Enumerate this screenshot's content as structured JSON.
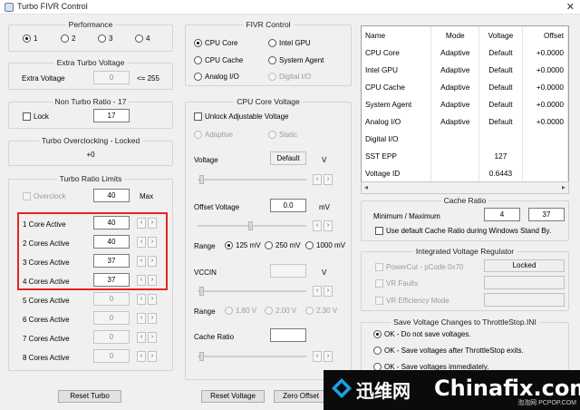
{
  "window": {
    "title": "Turbo FIVR Control",
    "close_glyph": "✕"
  },
  "performance": {
    "title": "Performance",
    "options": [
      "1",
      "2",
      "3",
      "4"
    ],
    "selected": "1"
  },
  "extra_turbo": {
    "title": "Extra Turbo Voltage",
    "label": "Extra Voltage",
    "value": "0",
    "limit": "<= 255"
  },
  "non_turbo": {
    "title": "Non Turbo Ratio - 17",
    "lock_label": "Lock",
    "value": "17"
  },
  "turbo_oc": {
    "title": "Turbo Overclocking - Locked",
    "value": "+0"
  },
  "turbo_limits": {
    "title": "Turbo Ratio Limits",
    "overclock_label": "Overclock",
    "overclock_value": "40",
    "max_label": "Max",
    "rows": [
      {
        "label": "1 Core Active",
        "value": "40"
      },
      {
        "label": "2 Cores Active",
        "value": "40"
      },
      {
        "label": "3 Cores Active",
        "value": "37"
      },
      {
        "label": "4 Cores Active",
        "value": "37"
      },
      {
        "label": "5 Cores Active",
        "value": "0"
      },
      {
        "label": "6 Cores Active",
        "value": "0"
      },
      {
        "label": "7 Cores Active",
        "value": "0"
      },
      {
        "label": "8 Cores Active",
        "value": "0"
      }
    ],
    "reset_label": "Reset Turbo"
  },
  "fivr": {
    "title": "FIVR Control",
    "domains": [
      "CPU Core",
      "Intel GPU",
      "CPU Cache",
      "System Agent",
      "Analog I/O",
      "Digital I/O"
    ],
    "selected": "CPU Core"
  },
  "core_voltage": {
    "title": "CPU Core Voltage",
    "unlock_label": "Unlock Adjustable Voltage",
    "mode_adaptive": "Adaptive",
    "mode_static": "Static",
    "voltage_label": "Voltage",
    "voltage_value": "Default",
    "voltage_unit": "V",
    "offset_label": "Offset Voltage",
    "offset_value": "0.0",
    "offset_unit": "mV",
    "range_label": "Range",
    "ranges": [
      "125 mV",
      "250 mV",
      "1000 mV"
    ],
    "range_selected": "125 mV",
    "vccin_label": "VCCIN",
    "vccin_unit": "V",
    "vccin_ranges": [
      "1.80 V",
      "2.00 V",
      "2.30 V"
    ],
    "cache_ratio_label": "Cache Ratio",
    "reset_voltage_label": "Reset Voltage",
    "zero_offset_label": "Zero Offset"
  },
  "status_table": {
    "headers": [
      "Name",
      "Mode",
      "Voltage",
      "Offset"
    ],
    "rows": [
      [
        "CPU Core",
        "Adaptive",
        "Default",
        "+0.0000"
      ],
      [
        "Intel GPU",
        "Adaptive",
        "Default",
        "+0.0000"
      ],
      [
        "CPU Cache",
        "Adaptive",
        "Default",
        "+0.0000"
      ],
      [
        "System Agent",
        "Adaptive",
        "Default",
        "+0.0000"
      ],
      [
        "Analog I/O",
        "Adaptive",
        "Default",
        "+0.0000"
      ],
      [
        "Digital I/O",
        "",
        "",
        ""
      ],
      [
        "SST EPP",
        "",
        "127",
        ""
      ],
      [
        "Voltage ID",
        "",
        "0.6443",
        ""
      ]
    ]
  },
  "cache_ratio": {
    "title": "Cache Ratio",
    "minmax_label": "Minimum / Maximum",
    "min": "4",
    "max": "37",
    "default_label": "Use default Cache Ratio during Windows Stand By."
  },
  "ivr": {
    "title": "Integrated Voltage Regulator",
    "powercut_label": "PowerCut  -  pCode 0x70",
    "locked_label": "Locked",
    "vr_faults_label": "VR Faults",
    "vr_eff_label": "VR Efficiency Mode"
  },
  "save": {
    "title": "Save Voltage Changes to ThrottleStop.INI",
    "options": [
      "OK - Do not save voltages.",
      "OK - Save voltages after ThrottleStop exits.",
      "OK - Save voltages immediately."
    ],
    "selected": "OK - Do not save voltages."
  },
  "watermark": {
    "cn_text": "迅维网",
    "brand": "Chinafix.com",
    "sub": "泡泡网 PCPOP.COM"
  }
}
